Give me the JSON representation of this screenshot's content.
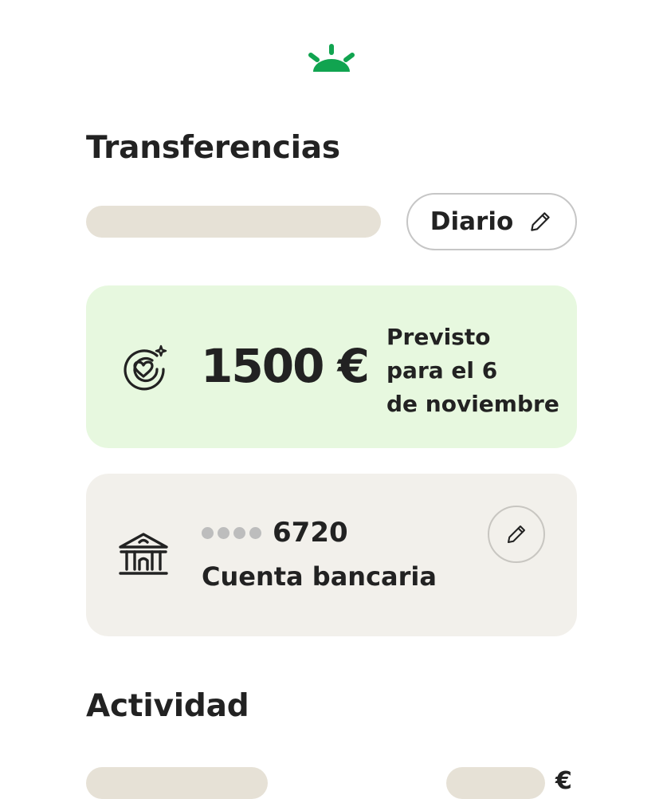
{
  "brand": {
    "accent": "#11a450",
    "logo_icon": "sunrise-logo-icon"
  },
  "transfers": {
    "title": "Transferencias",
    "frequency_label": "Diario",
    "frequency_icon": "pencil-icon",
    "amount_card": {
      "background": "#e7f8df",
      "icon": "goal-heart-icon",
      "amount": "1500 €",
      "schedule_lines": [
        "Previsto",
        "para el 6",
        "de noviembre"
      ]
    },
    "account_card": {
      "background": "#f2f0eb",
      "icon": "bank-icon",
      "masked_dots": "••••",
      "account_last_digits": "6720",
      "account_type": "Cuenta bancaria",
      "edit_icon": "pencil-icon"
    }
  },
  "activity": {
    "title": "Actividad",
    "currency_symbol": "€"
  },
  "colors": {
    "skeleton": "#e6e1d6",
    "text": "#222222"
  }
}
